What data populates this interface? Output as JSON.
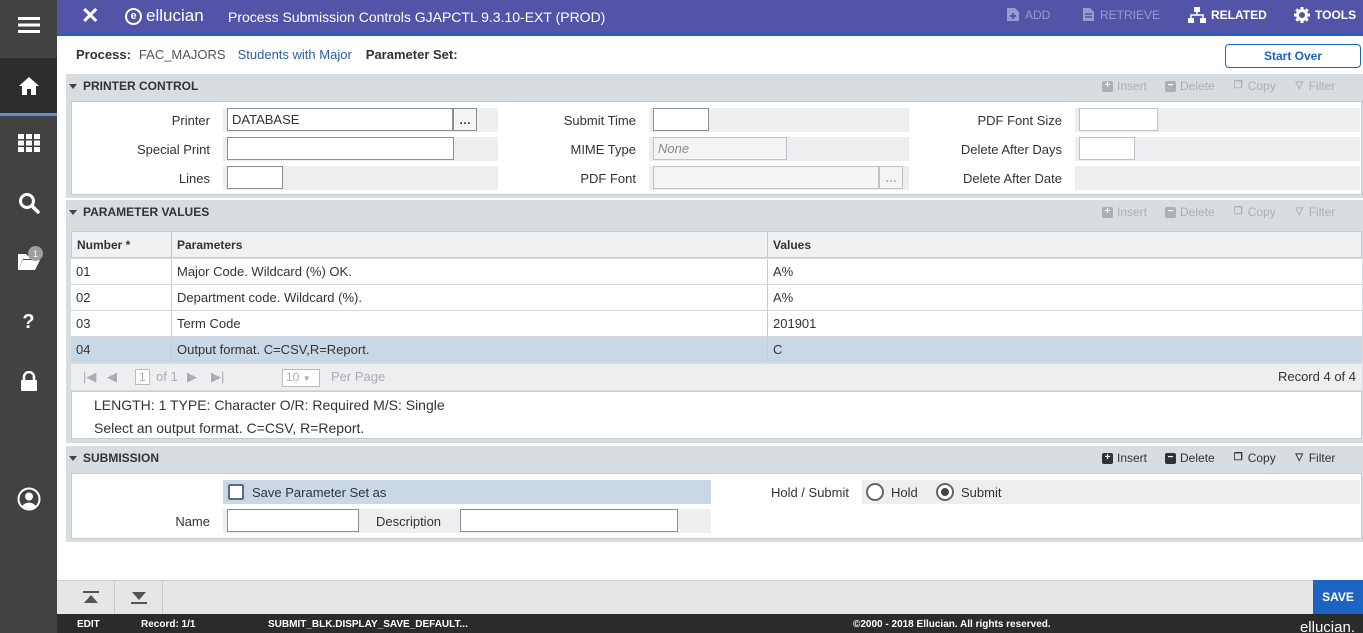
{
  "topbar": {
    "brand": "ellucian",
    "title": "Process Submission Controls GJAPCTL 9.3.10-EXT (PROD)",
    "add": "ADD",
    "retrieve": "RETRIEVE",
    "related": "RELATED",
    "tools": "TOOLS"
  },
  "sidebar": {
    "badge_count": "1"
  },
  "process": {
    "process_label": "Process:",
    "process_value": "FAC_MAJORS",
    "process_desc": "Students with Major",
    "param_set_label": "Parameter Set:",
    "start_over": "Start Over"
  },
  "actions": {
    "insert": "Insert",
    "delete": "Delete",
    "copy": "Copy",
    "filter": "Filter"
  },
  "printer_control": {
    "title": "PRINTER CONTROL",
    "printer_label": "Printer",
    "printer_value": "DATABASE",
    "special_print_label": "Special Print",
    "lines_label": "Lines",
    "submit_time_label": "Submit Time",
    "mime_type_label": "MIME Type",
    "mime_type_placeholder": "None",
    "pdf_font_label": "PDF Font",
    "pdf_font_size_label": "PDF Font Size",
    "delete_after_days_label": "Delete After Days",
    "delete_after_date_label": "Delete After Date"
  },
  "parameter_values": {
    "title": "PARAMETER VALUES",
    "columns": [
      "Number *",
      "Parameters",
      "Values"
    ],
    "rows": [
      {
        "number": "01",
        "parameter": "Major Code. Wildcard (%) OK.",
        "value": "A%"
      },
      {
        "number": "02",
        "parameter": "Department code. Wildcard (%).",
        "value": "A%"
      },
      {
        "number": "03",
        "parameter": "Term Code",
        "value": "201901"
      },
      {
        "number": "04",
        "parameter": "Output format. C=CSV,R=Report.",
        "value": "C"
      }
    ],
    "pager": {
      "page": "1",
      "of": "of 1",
      "per_page_value": "10",
      "per_page_label": "Per Page",
      "record": "Record 4 of 4"
    },
    "info_line1": "LENGTH: 1 TYPE: Character O/R: Required M/S: Single",
    "info_line2": "Select an output format.  C=CSV, R=Report."
  },
  "submission": {
    "title": "SUBMISSION",
    "save_param_set": "Save Parameter Set as",
    "hold_submit_label": "Hold / Submit",
    "hold": "Hold",
    "submit": "Submit",
    "name_label": "Name",
    "description_label": "Description"
  },
  "footer": {
    "save": "SAVE",
    "mode": "EDIT",
    "record": "Record: 1/1",
    "field": "SUBMIT_BLK.DISPLAY_SAVE_DEFAULT...",
    "copyright": "©2000 - 2018 Ellucian. All rights reserved.",
    "brand": "ellucian."
  }
}
